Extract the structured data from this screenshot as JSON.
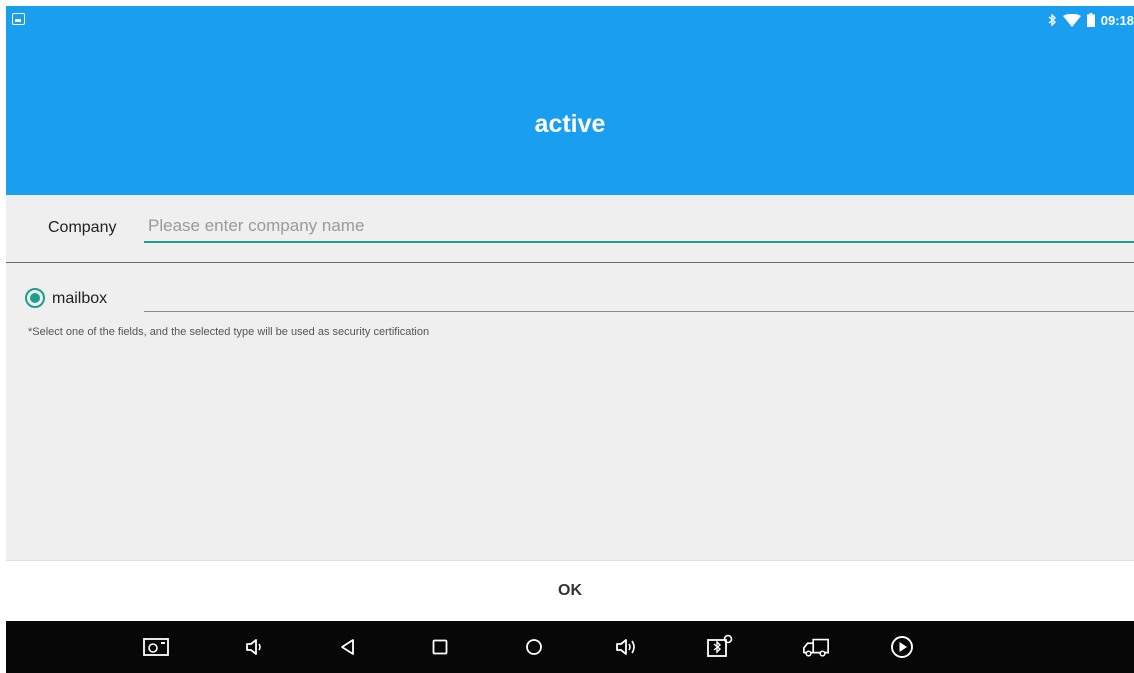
{
  "status_bar": {
    "time": "09:18",
    "icons": [
      "gallery-notification-icon",
      "bluetooth-icon",
      "wifi-icon",
      "battery-icon"
    ]
  },
  "app_bar": {
    "title": "active"
  },
  "form": {
    "company": {
      "label": "Company",
      "value": "",
      "placeholder": "Please enter company name"
    },
    "mailbox": {
      "label": "mailbox",
      "selected": true,
      "value": ""
    },
    "hint": "*Select one of the fields, and the selected type will be used as security certification"
  },
  "actions": {
    "ok_label": "OK"
  },
  "nav_bar": {
    "icons": [
      "screenshot-icon",
      "volume-down-icon",
      "back-icon",
      "recents-icon",
      "home-icon",
      "volume-up-icon",
      "bluetooth-settings-icon",
      "truck-icon",
      "play-icon"
    ]
  },
  "colors": {
    "primary": "#1a9ff0",
    "accent": "#1d9f8e",
    "background": "#efefef",
    "nav_background": "#070707"
  }
}
